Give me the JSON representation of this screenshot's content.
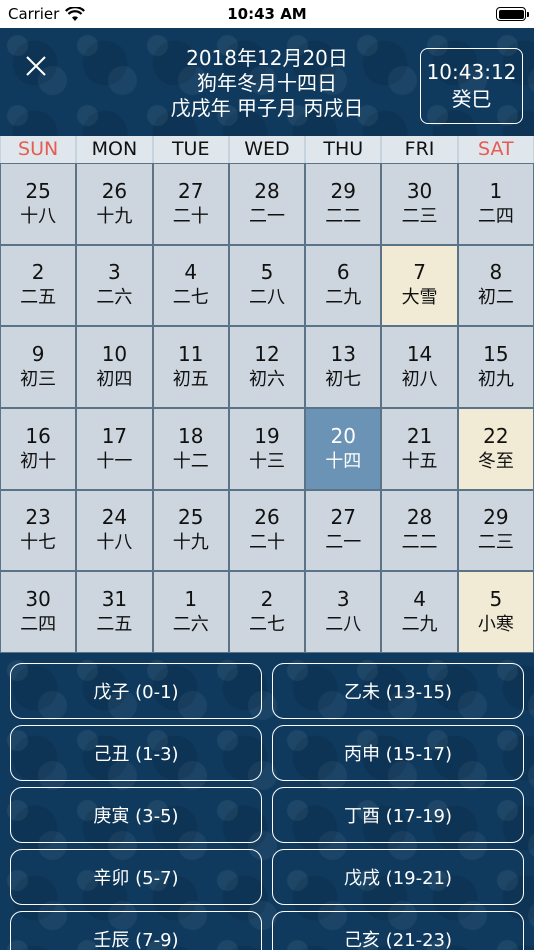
{
  "status_bar": {
    "carrier": "Carrier",
    "time": "10:43 AM"
  },
  "header": {
    "line1": "2018年12月20日",
    "line2": "狗年冬月十四日",
    "line3": "戊戌年 甲子月 丙戌日",
    "clock_time": "10:43:12",
    "clock_hour": "癸巳"
  },
  "weekdays": [
    "SUN",
    "MON",
    "TUE",
    "WED",
    "THU",
    "FRI",
    "SAT"
  ],
  "colors": {
    "weekend_red": "#e65b52",
    "solar_term_bg": "#f1ebd5",
    "today_bg": "#6a93b5"
  },
  "calendar": [
    [
      {
        "d": "25",
        "l": "十八"
      },
      {
        "d": "26",
        "l": "十九"
      },
      {
        "d": "27",
        "l": "二十"
      },
      {
        "d": "28",
        "l": "二一"
      },
      {
        "d": "29",
        "l": "二二"
      },
      {
        "d": "30",
        "l": "二三"
      },
      {
        "d": "1",
        "l": "二四"
      }
    ],
    [
      {
        "d": "2",
        "l": "二五"
      },
      {
        "d": "3",
        "l": "二六"
      },
      {
        "d": "4",
        "l": "二七"
      },
      {
        "d": "5",
        "l": "二八"
      },
      {
        "d": "6",
        "l": "二九"
      },
      {
        "d": "7",
        "l": "大雪",
        "term": true
      },
      {
        "d": "8",
        "l": "初二"
      }
    ],
    [
      {
        "d": "9",
        "l": "初三"
      },
      {
        "d": "10",
        "l": "初四"
      },
      {
        "d": "11",
        "l": "初五"
      },
      {
        "d": "12",
        "l": "初六"
      },
      {
        "d": "13",
        "l": "初七"
      },
      {
        "d": "14",
        "l": "初八"
      },
      {
        "d": "15",
        "l": "初九"
      }
    ],
    [
      {
        "d": "16",
        "l": "初十"
      },
      {
        "d": "17",
        "l": "十一"
      },
      {
        "d": "18",
        "l": "十二"
      },
      {
        "d": "19",
        "l": "十三"
      },
      {
        "d": "20",
        "l": "十四",
        "today": true
      },
      {
        "d": "21",
        "l": "十五"
      },
      {
        "d": "22",
        "l": "冬至",
        "term": true
      }
    ],
    [
      {
        "d": "23",
        "l": "十七"
      },
      {
        "d": "24",
        "l": "十八"
      },
      {
        "d": "25",
        "l": "十九"
      },
      {
        "d": "26",
        "l": "二十"
      },
      {
        "d": "27",
        "l": "二一"
      },
      {
        "d": "28",
        "l": "二二"
      },
      {
        "d": "29",
        "l": "二三"
      }
    ],
    [
      {
        "d": "30",
        "l": "二四"
      },
      {
        "d": "31",
        "l": "二五"
      },
      {
        "d": "1",
        "l": "二六"
      },
      {
        "d": "2",
        "l": "二七"
      },
      {
        "d": "3",
        "l": "二八"
      },
      {
        "d": "4",
        "l": "二九"
      },
      {
        "d": "5",
        "l": "小寒",
        "term": true
      }
    ]
  ],
  "hours": [
    "戊子 (0-1)",
    "乙未 (13-15)",
    "己丑 (1-3)",
    "丙申 (15-17)",
    "庚寅 (3-5)",
    "丁酉 (17-19)",
    "辛卯 (5-7)",
    "戊戌 (19-21)",
    "壬辰 (7-9)",
    "己亥 (21-23)"
  ]
}
